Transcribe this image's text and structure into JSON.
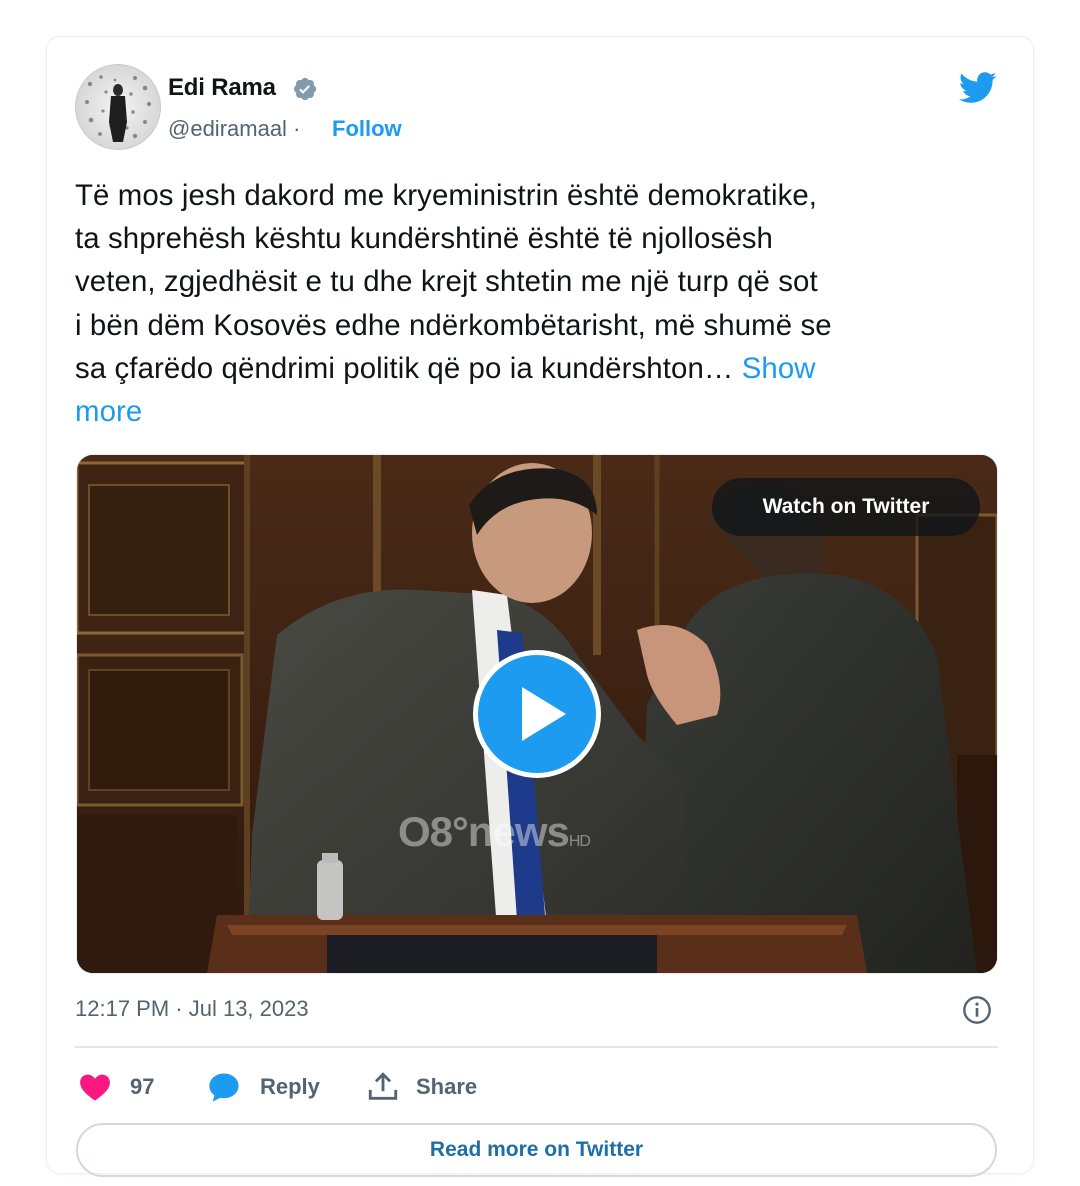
{
  "colors": {
    "accent": "#1d9bf0",
    "heart": "#f91880",
    "secondary_text": "#536471",
    "primary_text": "#0f1419"
  },
  "author": {
    "name": "Edi Rama",
    "handle": "@ediramaal",
    "handle_separator": "·",
    "follow_label": "Follow",
    "verified_icon": "verified-badge-icon",
    "logo_icon": "twitter-bird-icon"
  },
  "tweet": {
    "lines": [
      "Të mos jesh dakord me kryeministrin është demokratike,",
      "ta shprehësh kështu kundërshtinë është të njollosësh",
      "veten, zgjedhësit e tu dhe krejt shtetin me një turp që sot",
      "i bën dëm Kosovës edhe ndërkombëtarisht, më shumë se",
      "sa çfarëdo qëndrimi politik që po ia kundërshton…"
    ],
    "show_more_line1": "Show",
    "show_more_line2": "more"
  },
  "media": {
    "watch_label": "Watch on Twitter",
    "watermark": "O8°news",
    "watermark_suffix": "HD",
    "play_icon": "play-icon"
  },
  "meta": {
    "timestamp": "12:17 PM · Jul 13, 2023",
    "info_icon": "info-icon"
  },
  "actions": {
    "like_count": "97",
    "reply_label": "Reply",
    "share_label": "Share"
  },
  "footer": {
    "read_more_label": "Read more on Twitter"
  }
}
